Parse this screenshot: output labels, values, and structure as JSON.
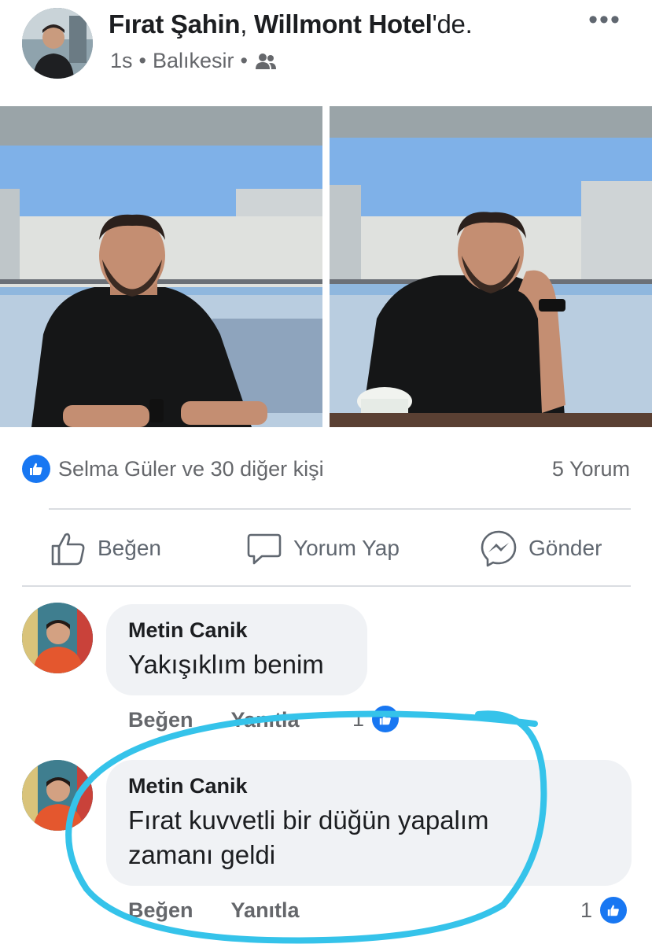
{
  "post": {
    "author": "Fırat Şahin",
    "separator": ", ",
    "location_name": "Willmont Hotel",
    "location_suffix": "'de.",
    "time": "1s",
    "city": "Balıkesir",
    "audience_icon": "friends-icon",
    "more_label": "•••"
  },
  "reactions": {
    "summary": "Selma Güler ve 30 diğer kişi",
    "comments": "5 Yorum"
  },
  "actions": {
    "like": "Beğen",
    "comment": "Yorum Yap",
    "send": "Gönder"
  },
  "comments": [
    {
      "author": "Metin Canik",
      "lines": [
        "Yakışıklım benim"
      ],
      "like_label": "Beğen",
      "reply_label": "Yanıtla",
      "like_count": "1"
    },
    {
      "author": "Metin Canik",
      "lines": [
        "Fırat kuvvetli bir düğün yapalım",
        "zamanı geldi"
      ],
      "like_label": "Beğen",
      "reply_label": "Yanıtla",
      "like_count": "1"
    }
  ],
  "colors": {
    "brand_blue": "#1877f2",
    "annotation_cyan": "#35c3ea",
    "bubble_bg": "#f0f2f5",
    "muted_text": "#65676b"
  }
}
